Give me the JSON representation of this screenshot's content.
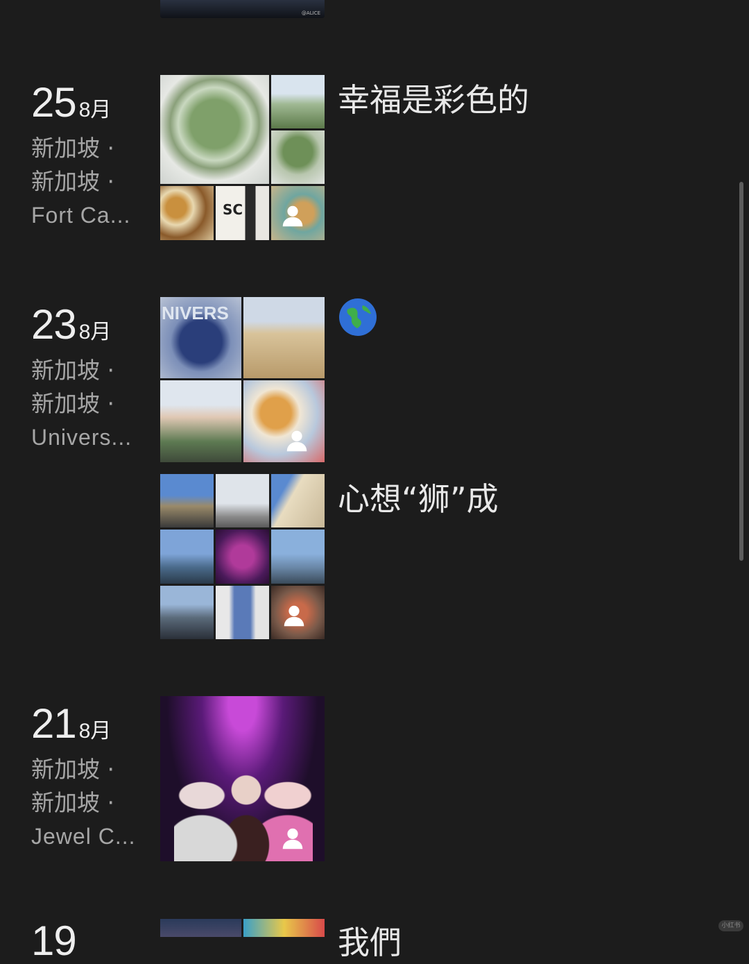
{
  "entries": [
    {
      "day": "25",
      "month": "8月",
      "location": [
        "新加坡 ·",
        "新加坡 ·",
        "Fort Ca..."
      ],
      "caption": "幸福是彩色的"
    },
    {
      "day": "23",
      "month": "8月",
      "location": [
        "新加坡 ·",
        "新加坡 ·",
        "Univers..."
      ],
      "caption": "🌏"
    },
    {
      "caption": "心想“狮”成"
    },
    {
      "day": "21",
      "month": "8月",
      "location": [
        "新加坡 ·",
        "新加坡 ·",
        "Jewel C..."
      ],
      "caption": ""
    },
    {
      "day": "19",
      "month": "",
      "caption": "我們"
    }
  ],
  "partial_grid_top": {
    "label_text": "@ALICE"
  },
  "icons": {
    "person": "person-icon",
    "earth": "globe-icon"
  },
  "colors": {
    "background": "#1c1c1c",
    "primary_text": "#eeeeee",
    "secondary_text": "#a6a6a6",
    "scrollbar": "#5c5c5c"
  }
}
